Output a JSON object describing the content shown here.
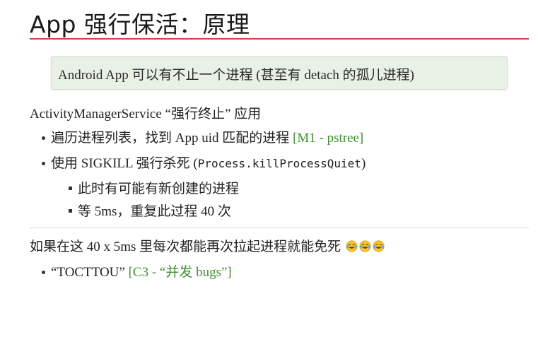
{
  "slide": {
    "title": "App 强行保活：原理",
    "note": "Android App 可以有不止一个进程 (甚至有 detach 的孤儿进程)",
    "section1": {
      "heading": "ActivityManagerService “强行终止” 应用",
      "bullets": [
        {
          "text": "遍历进程列表，找到 App uid 匹配的进程 ",
          "ref": "[M1 - pstree]"
        },
        {
          "text_before": "使用 SIGKILL 强行杀死 (",
          "code": "Process.killProcessQuiet",
          "text_after": ")"
        }
      ],
      "sub_bullets": [
        "此时有可能有新创建的进程",
        "等 5ms，重复此过程 40 次"
      ]
    },
    "section2": {
      "heading": "如果在这 40 x 5ms 里每次都能再次拉起进程就能免死",
      "emoji": [
        "face-with-tears-of-joy-icon",
        "face-with-tears-of-joy-icon",
        "face-with-tears-of-joy-icon"
      ],
      "bullets": [
        {
          "text": "“TOCTTOU” ",
          "ref": "[C3 - “并发 bugs”]"
        }
      ]
    },
    "colors": {
      "title_rule": "#c84a4a",
      "note_bg": "#e9f1e6",
      "reference_green": "#3f8f2f",
      "divider": "#d8d8d8"
    }
  }
}
